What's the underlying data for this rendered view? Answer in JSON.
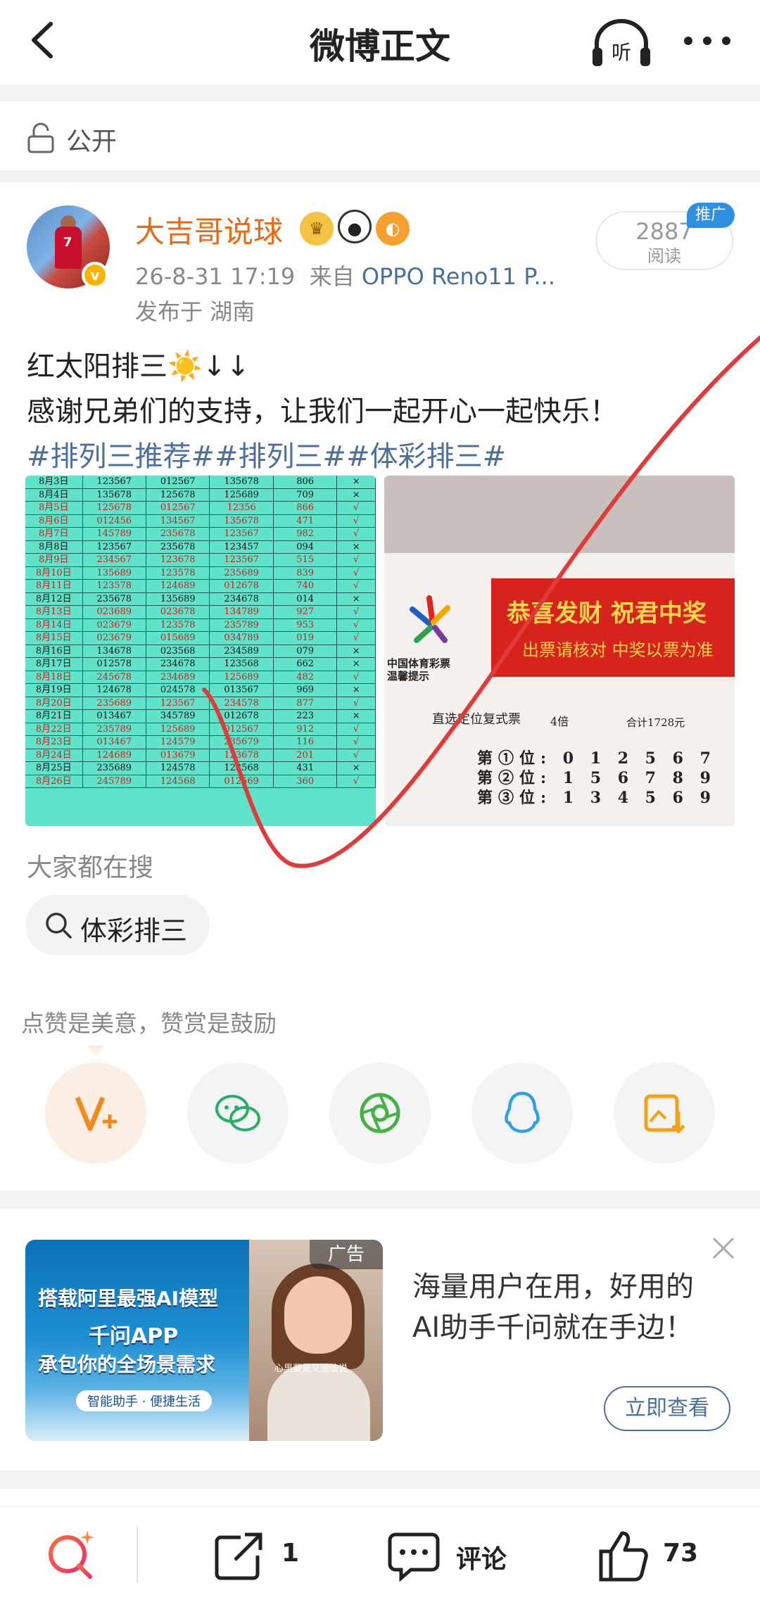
{
  "header": {
    "title": "微博正文",
    "listen_label": "听"
  },
  "privacy": {
    "label": "公开"
  },
  "author": {
    "name": "大吉哥说球",
    "time": "26-8-31 17:19",
    "source_prefix": "来自",
    "device": "OPPO Reno11 P...",
    "location": "发布于 湖南",
    "avatar_number": "7",
    "read_count": "2887",
    "read_label": "阅读",
    "promo_badge": "推广"
  },
  "post": {
    "line1": "红太阳排三☀️↓↓",
    "line2": "感谢兄弟们的支持，让我们一起开心一起快乐！",
    "tags": "#排列三推荐##排列三##体彩排三#"
  },
  "table_image": {
    "rows": [
      {
        "d": "8月3日",
        "a": "123567",
        "b": "012567",
        "c": "135678",
        "n": "806",
        "r": "×"
      },
      {
        "d": "8月4日",
        "a": "135678",
        "b": "125678",
        "c": "125689",
        "n": "709",
        "r": "×"
      },
      {
        "d": "8月5日",
        "a": "125678",
        "b": "012567",
        "c": "12356",
        "n": "866",
        "r": "√"
      },
      {
        "d": "8月6日",
        "a": "012456",
        "b": "134567",
        "c": "135678",
        "n": "471",
        "r": "√"
      },
      {
        "d": "8月7日",
        "a": "145789",
        "b": "235678",
        "c": "123567",
        "n": "982",
        "r": "√"
      },
      {
        "d": "8月8日",
        "a": "123567",
        "b": "235678",
        "c": "123457",
        "n": "094",
        "r": "×"
      },
      {
        "d": "8月9日",
        "a": "234567",
        "b": "123678",
        "c": "123567",
        "n": "515",
        "r": "√"
      },
      {
        "d": "8月10日",
        "a": "135689",
        "b": "123578",
        "c": "235689",
        "n": "839",
        "r": "√"
      },
      {
        "d": "8月11日",
        "a": "123578",
        "b": "124689",
        "c": "012678",
        "n": "740",
        "r": "√"
      },
      {
        "d": "8月12日",
        "a": "235678",
        "b": "135689",
        "c": "234678",
        "n": "014",
        "r": "×"
      },
      {
        "d": "8月13日",
        "a": "023689",
        "b": "023678",
        "c": "134789",
        "n": "927",
        "r": "√"
      },
      {
        "d": "8月14日",
        "a": "023679",
        "b": "123578",
        "c": "235789",
        "n": "953",
        "r": "√"
      },
      {
        "d": "8月15日",
        "a": "023679",
        "b": "015689",
        "c": "034789",
        "n": "019",
        "r": "√"
      },
      {
        "d": "8月16日",
        "a": "134678",
        "b": "023568",
        "c": "234589",
        "n": "079",
        "r": "×"
      },
      {
        "d": "8月17日",
        "a": "012578",
        "b": "234678",
        "c": "123568",
        "n": "662",
        "r": "×"
      },
      {
        "d": "8月18日",
        "a": "245678",
        "b": "234689",
        "c": "125689",
        "n": "482",
        "r": "√"
      },
      {
        "d": "8月19日",
        "a": "124678",
        "b": "024578",
        "c": "013567",
        "n": "969",
        "r": "×"
      },
      {
        "d": "8月20日",
        "a": "235689",
        "b": "123567",
        "c": "234578",
        "n": "877",
        "r": "√"
      },
      {
        "d": "8月21日",
        "a": "013467",
        "b": "345789",
        "c": "012678",
        "n": "223",
        "r": "×"
      },
      {
        "d": "8月22日",
        "a": "235789",
        "b": "125689",
        "c": "012567",
        "n": "912",
        "r": "√"
      },
      {
        "d": "8月23日",
        "a": "013467",
        "b": "124579",
        "c": "235679",
        "n": "116",
        "r": "√"
      },
      {
        "d": "8月24日",
        "a": "124689",
        "b": "013679",
        "c": "123678",
        "n": "201",
        "r": "√"
      },
      {
        "d": "8月25日",
        "a": "235689",
        "b": "124578",
        "c": "123568",
        "n": "431",
        "r": "×"
      },
      {
        "d": "8月26日",
        "a": "245789",
        "b": "124568",
        "c": "012569",
        "n": "360",
        "r": "√"
      }
    ],
    "red_rows": [
      2,
      3,
      4,
      6,
      7,
      8,
      10,
      11,
      12,
      15,
      17,
      19,
      20,
      21,
      23
    ]
  },
  "ticket_image": {
    "banner_main": "恭喜发财 祝君中奖",
    "banner_sub": "出票请核对 中奖以票为准",
    "org_label": "中国体育彩票\n温馨提示",
    "bet_type": "直选定位复式票",
    "multiple": "4倍",
    "total": "合计1728元",
    "pos1": "第①位: 0 1 2 5 6 7",
    "pos2": "第②位: 1 5 6 7 8 9",
    "pos3": "第③位: 1 3 4 5 6 9"
  },
  "search": {
    "heading": "大家都在搜",
    "chip": "体彩排三"
  },
  "share": {
    "hint": "点赞是美意，赞赏是鼓励"
  },
  "ad": {
    "tag": "广告",
    "img_line1": "搭载阿里最强AI模型",
    "img_line2": "千问APP",
    "img_line3": "承包你的全场景需求",
    "img_pill": "智能助手 · 便捷生活",
    "img_caption": "心里要是又没法说",
    "text_line1": "海量用户在用，好用的",
    "text_line2": "AI助手千问就在手边！",
    "button": "立即查看"
  },
  "bottom": {
    "repost_count": "1",
    "comment_label": "评论",
    "like_count": "73"
  },
  "colors": {
    "accent": "#e86a16",
    "link": "#4a6f9e",
    "swirl": "#e03a3a"
  }
}
